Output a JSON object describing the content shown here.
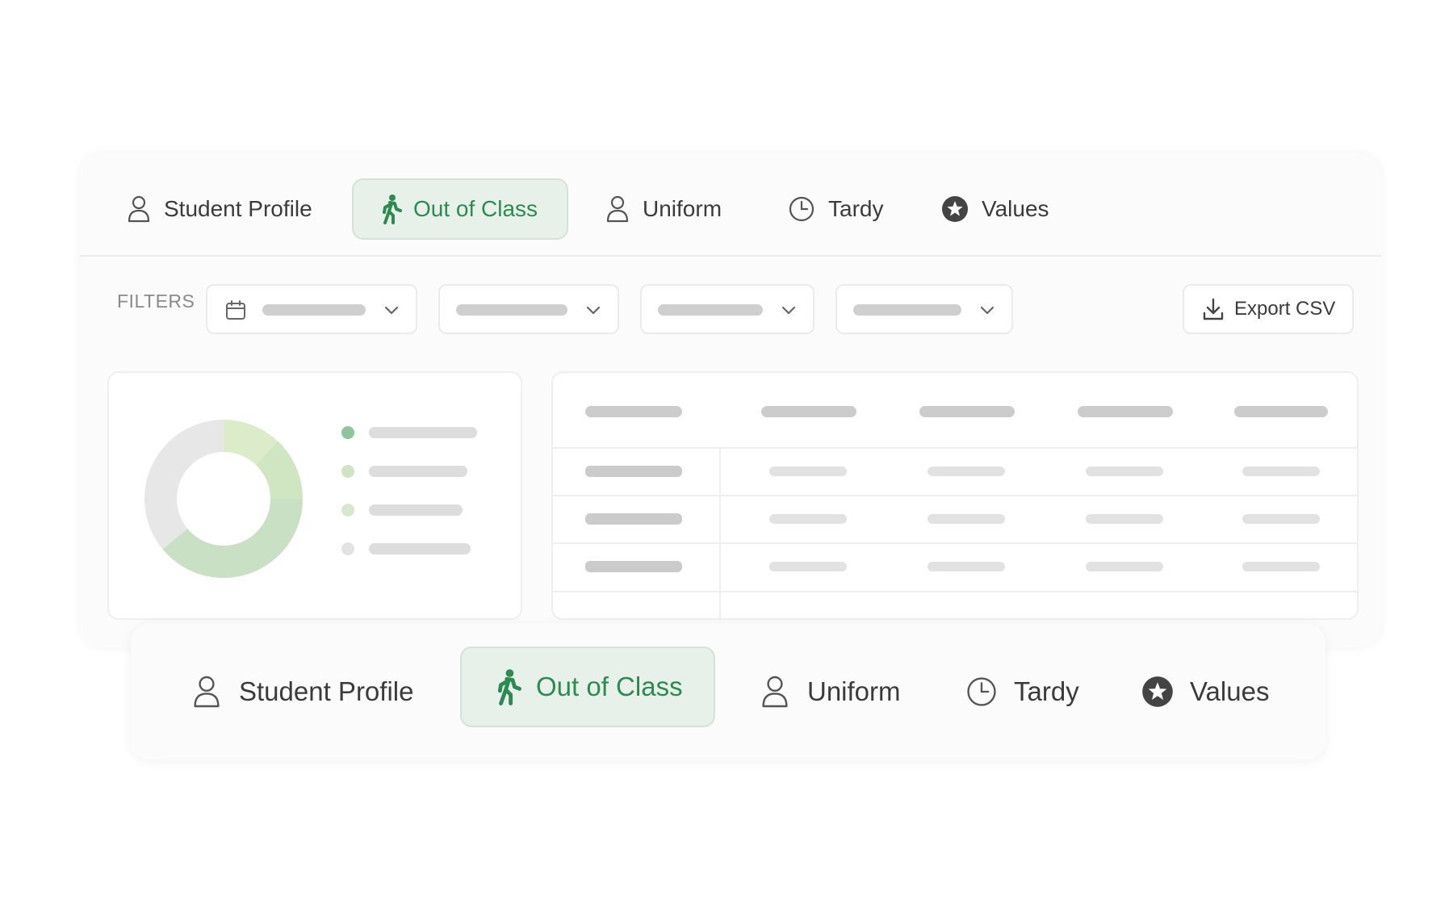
{
  "tabs": {
    "student_profile": "Student Profile",
    "out_of_class": "Out of Class",
    "uniform": "Uniform",
    "tardy": "Tardy",
    "values": "Values"
  },
  "active_tab": "out_of_class",
  "filters": {
    "label": "FILTERS",
    "dropdowns": [
      {
        "icon": "calendar-icon",
        "value": ""
      },
      {
        "icon": "",
        "value": ""
      },
      {
        "icon": "",
        "value": ""
      },
      {
        "icon": "",
        "value": ""
      }
    ],
    "export_label": "Export CSV"
  },
  "colors": {
    "accent": "#2c8a52",
    "active_tab_bg": "#e8f1e9",
    "donut": [
      "#d7e9c4",
      "#c8e0bd",
      "#e6e6e6"
    ]
  },
  "donut_chart": {
    "segments": [
      {
        "value": 0.12,
        "color": "#dcecca"
      },
      {
        "value": 0.13,
        "color": "#d0e5c2"
      },
      {
        "value": 0.39,
        "color": "#c9e0c4"
      },
      {
        "value": 0.36,
        "color": "#e7e7e7"
      }
    ],
    "legend_dots": [
      "#8fc49c",
      "#cfe4c2",
      "#d8e8cf",
      "#e3e3e3"
    ]
  },
  "table": {
    "columns": 5,
    "rows": 4
  },
  "bottom_tabs": {
    "student_profile": "Student Profile",
    "out_of_class": "Out of Class",
    "uniform": "Uniform",
    "tardy": "Tardy",
    "values": "Values"
  }
}
